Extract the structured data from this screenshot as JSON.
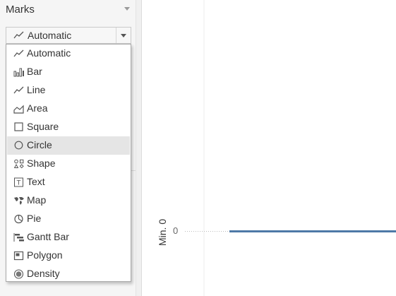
{
  "marks_panel": {
    "title": "Marks",
    "selected_mark": "Automatic"
  },
  "mark_type_menu": {
    "items": [
      {
        "label": "Automatic",
        "icon": "automatic-line-icon"
      },
      {
        "label": "Bar",
        "icon": "bar-icon"
      },
      {
        "label": "Line",
        "icon": "line-icon"
      },
      {
        "label": "Area",
        "icon": "area-icon"
      },
      {
        "label": "Square",
        "icon": "square-icon"
      },
      {
        "label": "Circle",
        "icon": "circle-icon",
        "highlighted": true
      },
      {
        "label": "Shape",
        "icon": "shape-icon"
      },
      {
        "label": "Text",
        "icon": "text-icon"
      },
      {
        "label": "Map",
        "icon": "map-icon"
      },
      {
        "label": "Pie",
        "icon": "pie-icon"
      },
      {
        "label": "Gantt Bar",
        "icon": "gantt-bar-icon"
      },
      {
        "label": "Polygon",
        "icon": "polygon-icon"
      },
      {
        "label": "Density",
        "icon": "density-icon"
      }
    ]
  },
  "view": {
    "axis_title": "Min. 0",
    "tick_label": "0",
    "line_color": "#4e79a7"
  }
}
